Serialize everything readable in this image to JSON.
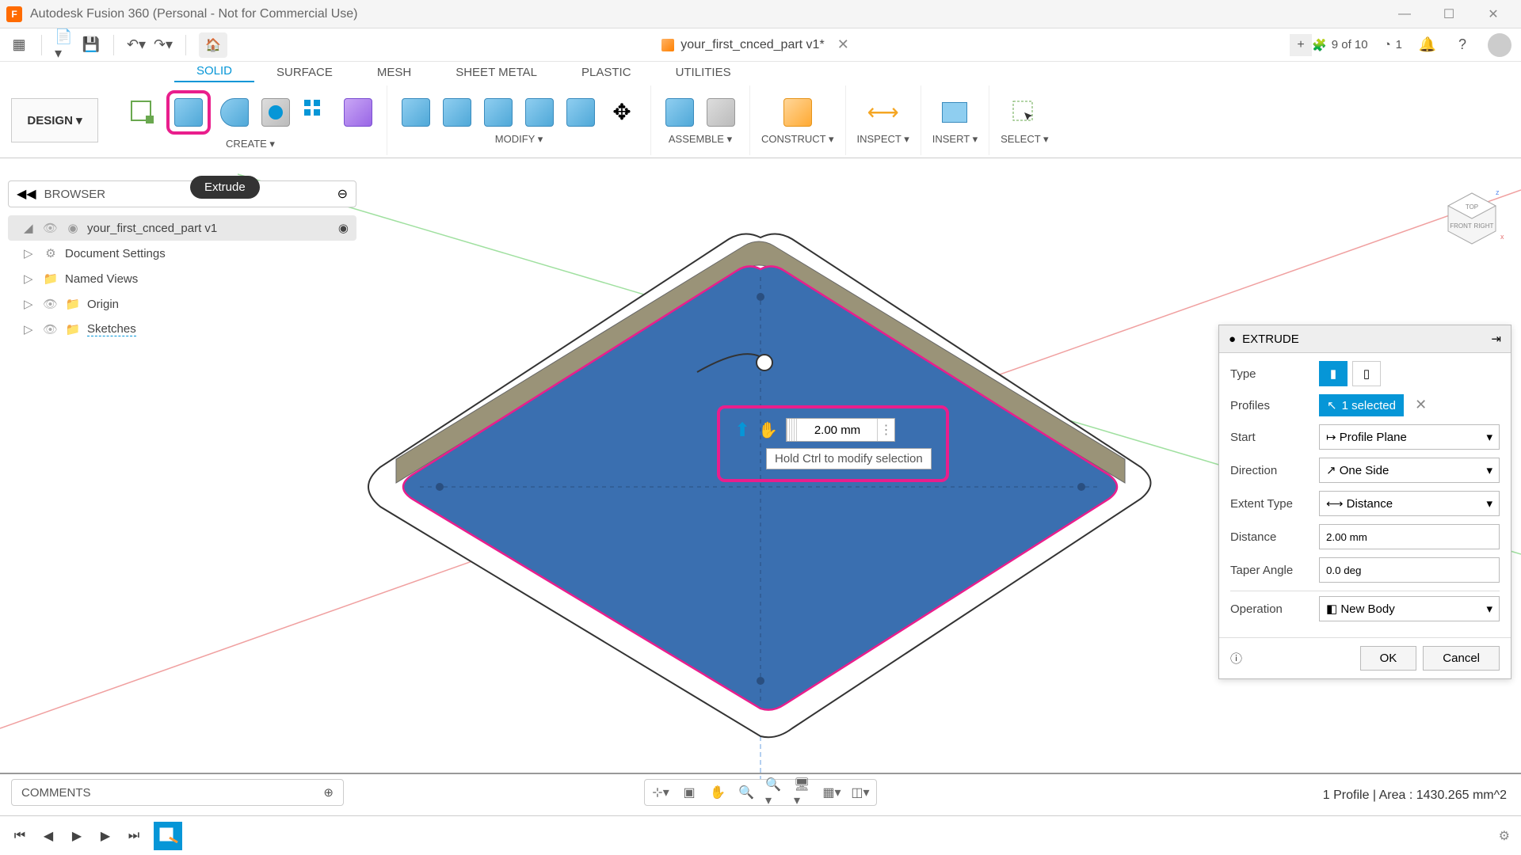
{
  "titlebar": {
    "app_title": "Autodesk Fusion 360 (Personal - Not for Commercial Use)"
  },
  "doc": {
    "title": "your_first_cnced_part v1*"
  },
  "qat": {
    "progress": "9 of 10",
    "notif_count": "1"
  },
  "ribbon": {
    "tabs": [
      "SOLID",
      "SURFACE",
      "MESH",
      "SHEET METAL",
      "PLASTIC",
      "UTILITIES"
    ],
    "design_label": "DESIGN ▾",
    "create_label": "CREATE ▾",
    "modify_label": "MODIFY ▾",
    "assemble_label": "ASSEMBLE ▾",
    "construct_label": "CONSTRUCT ▾",
    "inspect_label": "INSPECT ▾",
    "insert_label": "INSERT ▾",
    "select_label": "SELECT ▾"
  },
  "browser": {
    "title": "BROWSER",
    "tooltip": "Extrude",
    "root": "your_first_cnced_part v1",
    "items": [
      "Document Settings",
      "Named Views",
      "Origin",
      "Sketches"
    ]
  },
  "callout": {
    "value": "2.00 mm",
    "hint": "Hold Ctrl to modify selection"
  },
  "panel": {
    "title": "EXTRUDE",
    "type_label": "Type",
    "profiles_label": "Profiles",
    "profiles_value": "1 selected",
    "start_label": "Start",
    "start_value": "Profile Plane",
    "direction_label": "Direction",
    "direction_value": "One Side",
    "extent_label": "Extent Type",
    "extent_value": "Distance",
    "distance_label": "Distance",
    "distance_value": "2.00 mm",
    "taper_label": "Taper Angle",
    "taper_value": "0.0 deg",
    "operation_label": "Operation",
    "operation_value": "New Body",
    "ok": "OK",
    "cancel": "Cancel"
  },
  "comments": {
    "label": "COMMENTS"
  },
  "status": {
    "text": "1 Profile | Area : 1430.265 mm^2"
  },
  "viewcube": {
    "top": "TOP",
    "front": "FRONT",
    "right": "RIGHT"
  }
}
